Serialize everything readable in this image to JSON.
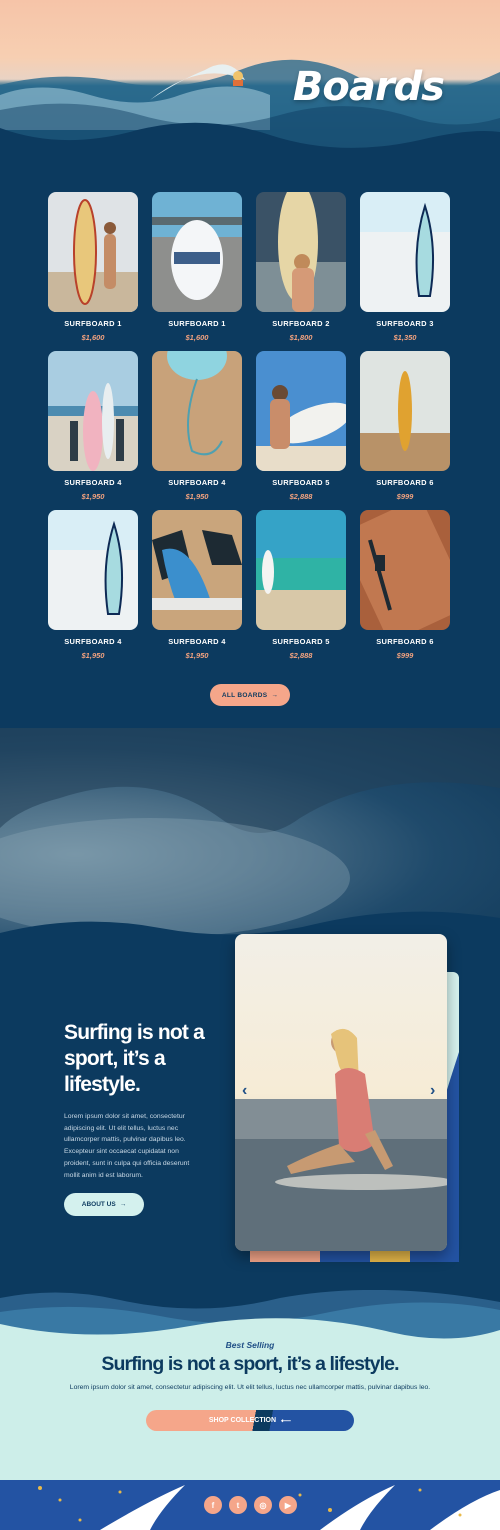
{
  "hero": {
    "title": "Boards"
  },
  "products": [
    {
      "name": "SURFBOARD 1",
      "price": "$1,600"
    },
    {
      "name": "SURFBOARD 1",
      "price": "$1,600"
    },
    {
      "name": "SURFBOARD 2",
      "price": "$1,800"
    },
    {
      "name": "SURFBOARD 3",
      "price": "$1,350"
    },
    {
      "name": "SURFBOARD 4",
      "price": "$1,950"
    },
    {
      "name": "SURFBOARD 4",
      "price": "$1,950"
    },
    {
      "name": "SURFBOARD 5",
      "price": "$2,888"
    },
    {
      "name": "SURFBOARD 6",
      "price": "$999"
    },
    {
      "name": "SURFBOARD 4",
      "price": "$1,950"
    },
    {
      "name": "SURFBOARD 4",
      "price": "$1,950"
    },
    {
      "name": "SURFBOARD 5",
      "price": "$2,888"
    },
    {
      "name": "SURFBOARD 6",
      "price": "$999"
    }
  ],
  "all_boards": {
    "label": "ALL BOARDS",
    "arrow": "→"
  },
  "lifestyle": {
    "title": "Surfing is not a sport, it’s a lifestyle.",
    "body": "Lorem ipsum dolor sit amet, consectetur adipiscing elit. Ut elit tellus, luctus nec ullamcorper mattis, pulvinar dapibus leo. Excepteur sint occaecat cupidatat non proident, sunt in culpa qui officia deserunt mollit anim id est laborum.",
    "button": "ABOUT US",
    "button_arrow": "→",
    "prev": "‹",
    "next": "›"
  },
  "best_selling": {
    "kicker": "Best Selling",
    "title": "Surfing is not a sport, it’s a lifestyle.",
    "body": "Lorem ipsum dolor sit amet, consectetur adipiscing elit. Ut elit tellus, luctus nec ullamcorper mattis, pulvinar dapibus leo.",
    "button": "SHOP COLLECTION",
    "button_arrow": "⟵"
  },
  "footer": {
    "socials": [
      {
        "icon": "facebook-icon",
        "glyph": "f"
      },
      {
        "icon": "twitter-icon",
        "glyph": "t"
      },
      {
        "icon": "instagram-icon",
        "glyph": "◎"
      },
      {
        "icon": "youtube-icon",
        "glyph": "▶"
      }
    ]
  },
  "colors": {
    "navy": "#0c3a5f",
    "peach": "#f5a68a",
    "mint": "#d4f1ee",
    "blue": "#2353a3"
  }
}
